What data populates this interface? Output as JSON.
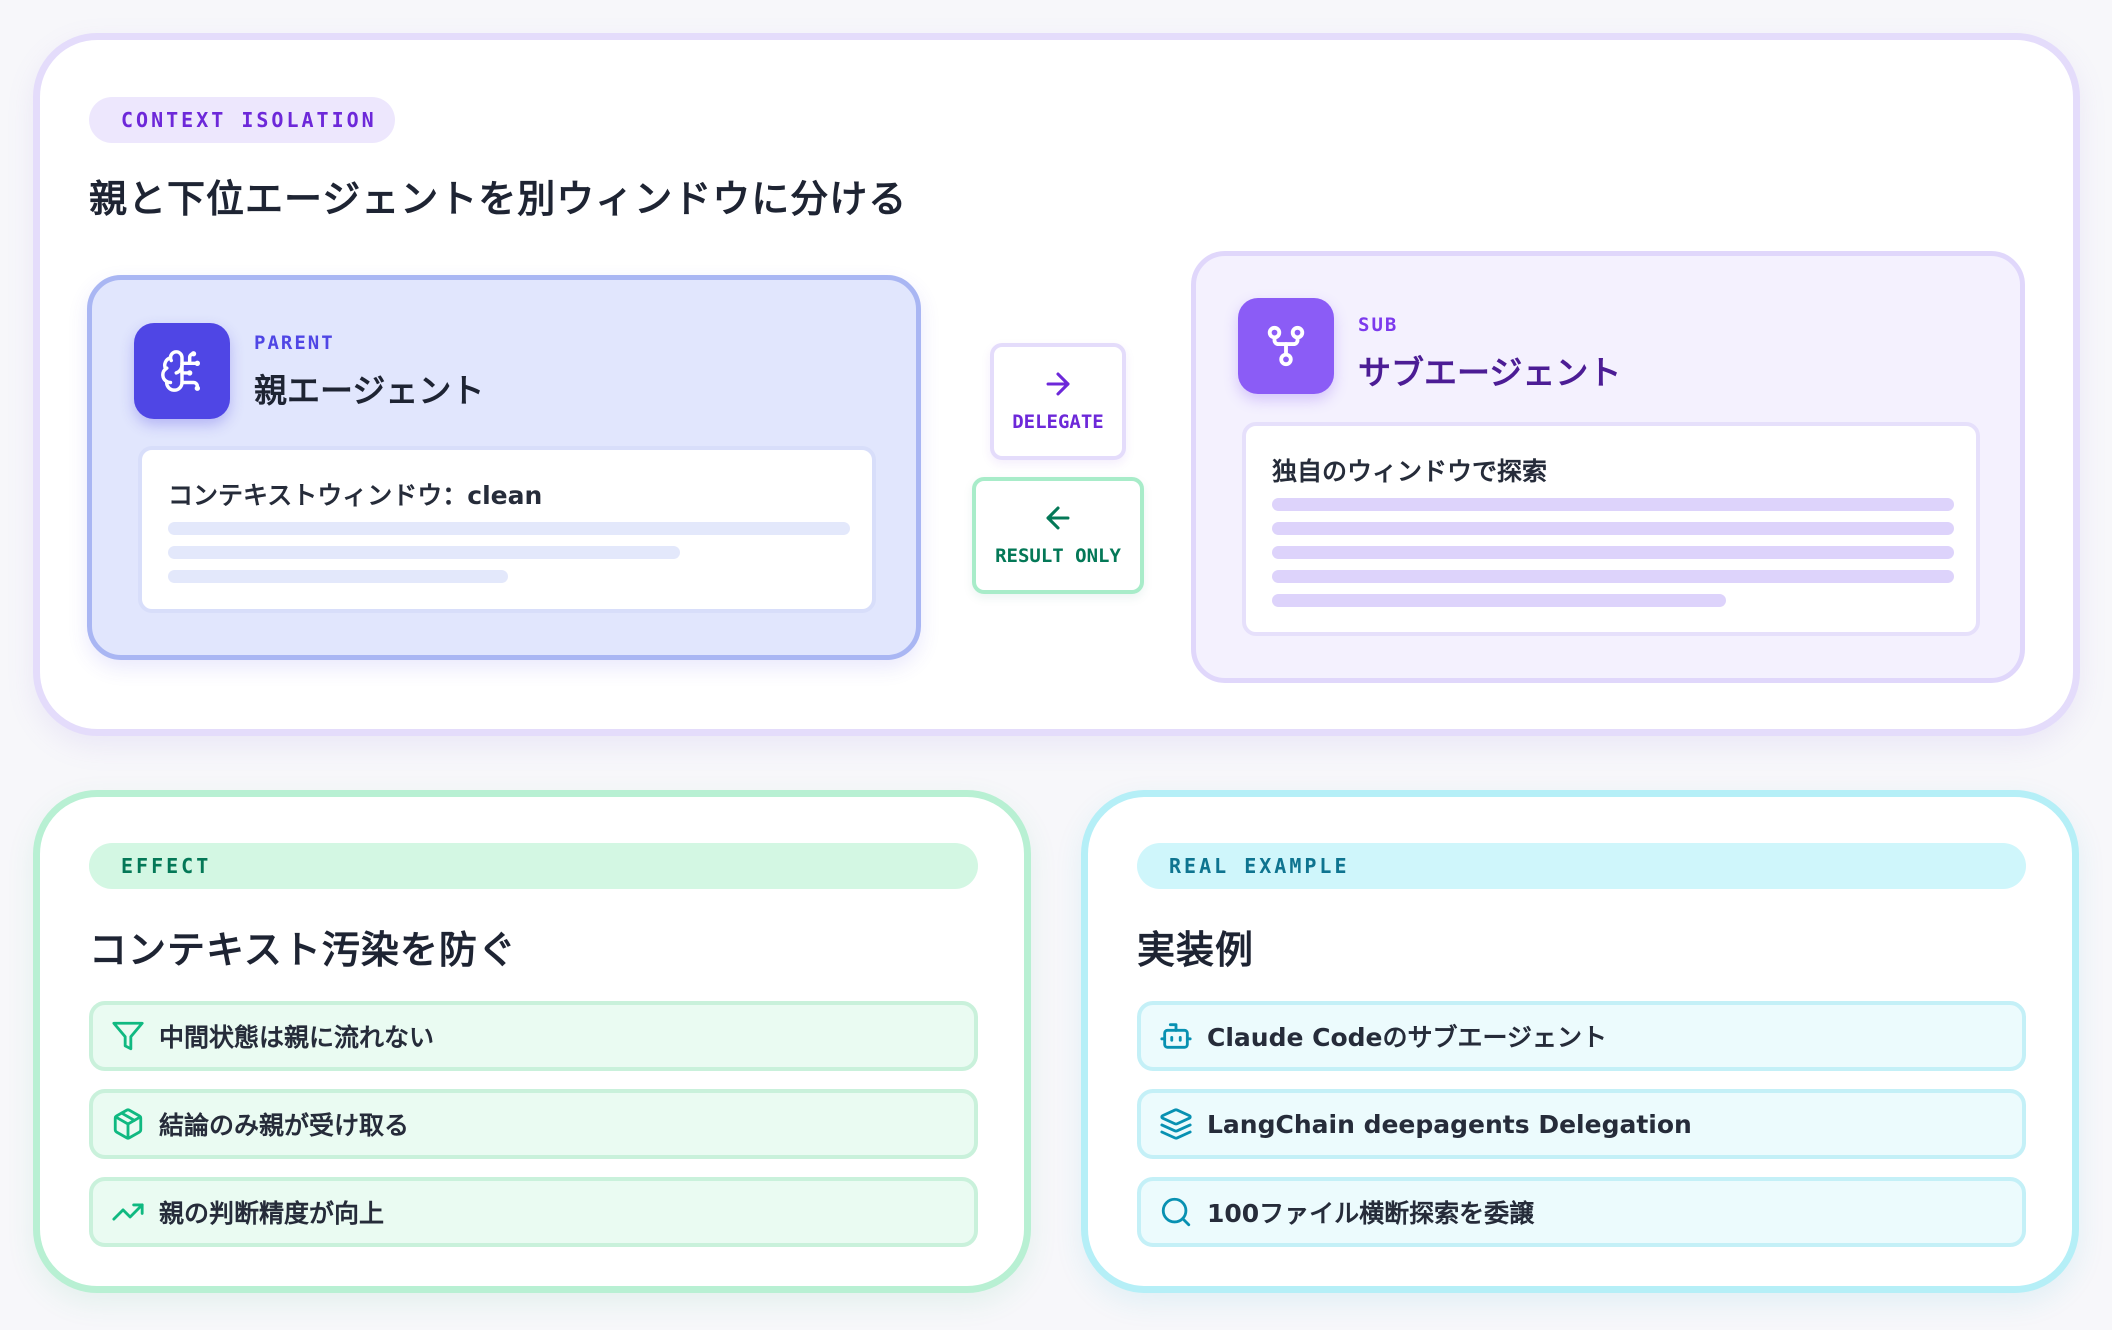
{
  "top": {
    "badge": "CONTEXT ISOLATION",
    "title": "親と下位エージェントを別ウィンドウに分ける",
    "parent": {
      "role": "PARENT",
      "name": "親エージェント",
      "window_label": "コンテキストウィンドウ：clean",
      "icon": "brain-icon"
    },
    "delegate": {
      "label": "DELEGATE",
      "icon": "arrow-right-icon"
    },
    "result": {
      "label": "RESULT ONLY",
      "icon": "arrow-left-icon"
    },
    "sub": {
      "role": "SUB",
      "name": "サブエージェント",
      "window_label": "独自のウィンドウで探索",
      "icon": "git-branch-icon"
    }
  },
  "effect": {
    "badge": "EFFECT",
    "title": "コンテキスト汚染を防ぐ",
    "items": [
      {
        "label": "中間状態は親に流れない",
        "icon": "filter-icon"
      },
      {
        "label": "結論のみ親が受け取る",
        "icon": "package-icon"
      },
      {
        "label": "親の判断精度が向上",
        "icon": "trending-up-icon"
      }
    ]
  },
  "example": {
    "badge": "REAL EXAMPLE",
    "title": "実装例",
    "items": [
      {
        "label": "Claude Codeのサブエージェント",
        "icon": "bot-icon"
      },
      {
        "label": "LangChain deepagents Delegation",
        "icon": "layers-icon"
      },
      {
        "label": "100ファイル横断探索を委譲",
        "icon": "search-icon"
      }
    ]
  },
  "colors": {
    "purple_accent": "#6d28d9",
    "parent_indigo": "#4f46e5",
    "sub_violet": "#8b5cf6",
    "green_accent": "#047857",
    "cyan_accent": "#0e7490"
  }
}
